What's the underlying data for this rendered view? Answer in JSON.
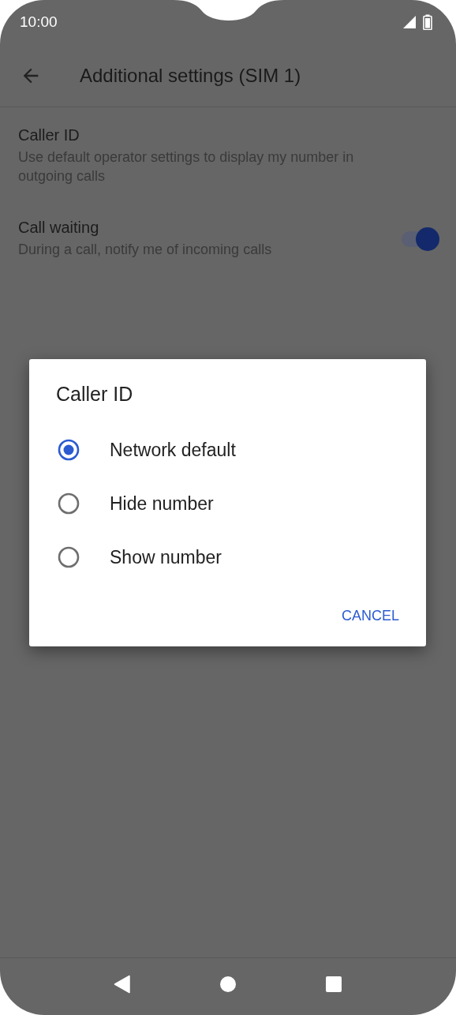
{
  "status_bar": {
    "time": "10:00"
  },
  "app_bar": {
    "title": "Additional settings (SIM 1)"
  },
  "settings": [
    {
      "kind": "text",
      "title": "Caller ID",
      "summary": "Use default operator settings to display my number in outgoing calls"
    },
    {
      "kind": "switch",
      "title": "Call waiting",
      "summary": "During a call, notify me of incoming calls",
      "on": true
    }
  ],
  "dialog": {
    "title": "Caller ID",
    "options": [
      {
        "label": "Network default",
        "selected": true
      },
      {
        "label": "Hide number",
        "selected": false
      },
      {
        "label": "Show number",
        "selected": false
      }
    ],
    "buttons": [
      "CANCEL"
    ]
  }
}
